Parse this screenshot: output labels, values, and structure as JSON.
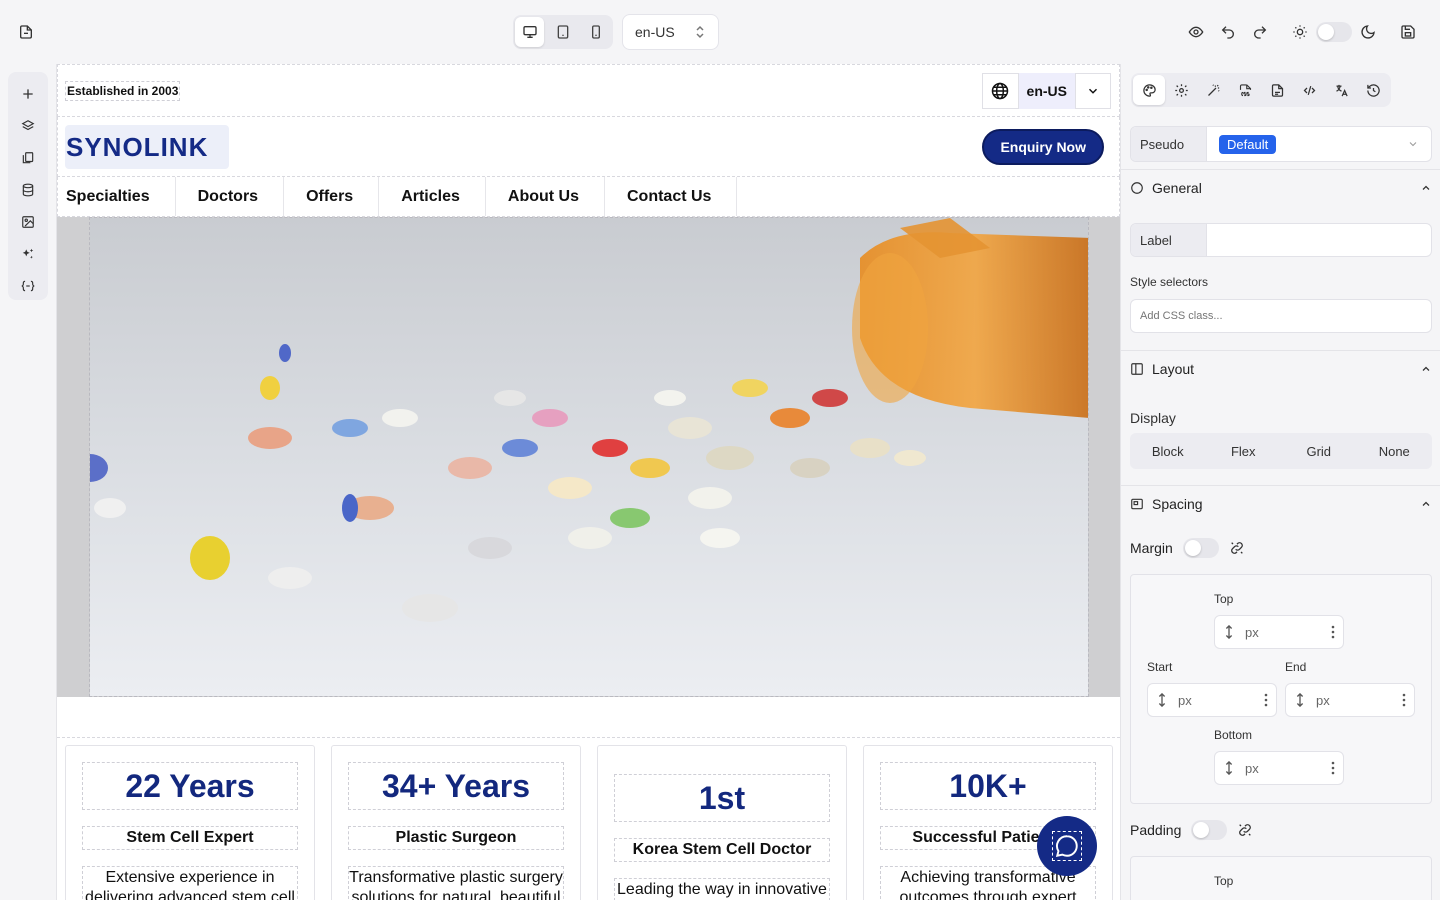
{
  "toolbar": {
    "locale": "en-US",
    "devices": [
      "desktop",
      "tablet",
      "mobile"
    ],
    "active_device": "desktop"
  },
  "left_rail": {
    "icons": [
      "plus-icon",
      "layers-icon",
      "pages-icon",
      "database-icon",
      "image-icon",
      "sparkles-icon",
      "variables-icon"
    ]
  },
  "site": {
    "established": "Established in 2003",
    "lang_code": "en-US",
    "logo_text": "SYNOLINK",
    "enquiry": "Enquiry Now",
    "nav": [
      "Specialties",
      "Doctors",
      "Offers",
      "Articles",
      "About Us",
      "Contact Us"
    ],
    "cards": [
      {
        "stat": "22 Years",
        "title": "Stem Cell Expert",
        "desc": "Extensive experience in delivering advanced stem cell"
      },
      {
        "stat": "34+ Years",
        "title": "Plastic Surgeon",
        "desc": "Transformative plastic surgery solutions for natural, beautiful"
      },
      {
        "stat": "1st",
        "title": "Korea Stem Cell Doctor",
        "desc": "Leading the way in innovative"
      },
      {
        "stat": "10K+",
        "title": "Successful Patients",
        "desc": "Achieving transformative outcomes through expert"
      }
    ]
  },
  "panel": {
    "pseudo_label": "Pseudo",
    "pseudo_value": "Default",
    "general": "General",
    "label_field": "Label",
    "style_selectors": "Style selectors",
    "css_placeholder": "Add CSS class...",
    "layout": "Layout",
    "display": "Display",
    "display_options": [
      "Block",
      "Flex",
      "Grid",
      "None"
    ],
    "spacing": "Spacing",
    "margin": "Margin",
    "padding": "Padding",
    "top": "Top",
    "start": "Start",
    "end": "End",
    "bottom": "Bottom",
    "unit": "px",
    "padding_top": "Top"
  },
  "colors": {
    "brand": "#142a86",
    "accent_blue": "#2563eb"
  }
}
